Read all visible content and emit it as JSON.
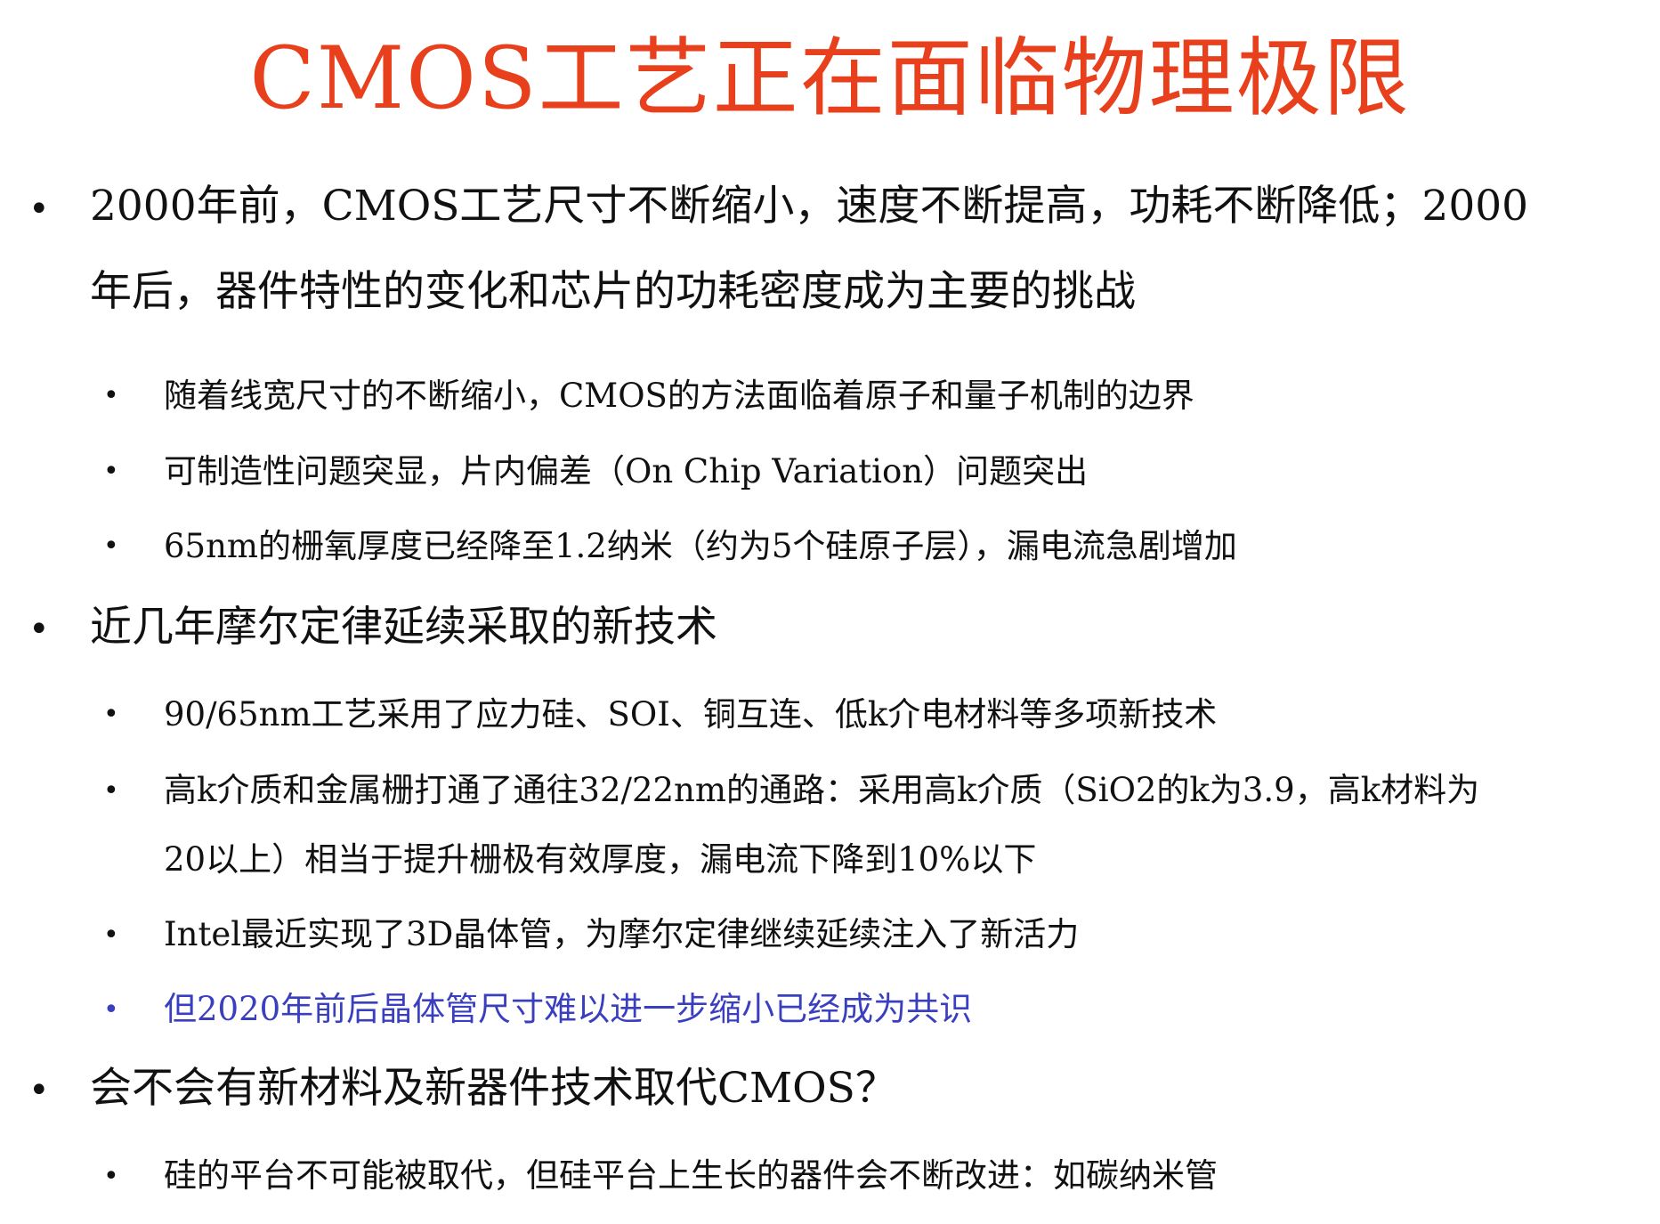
{
  "title": "CMOS工艺正在面临物理极限",
  "colors": {
    "title": "#e8401c",
    "text": "#111111",
    "highlight": "#3a3fc0"
  },
  "bullets": [
    {
      "lines": [
        "2000年前，CMOS工艺尺寸不断缩小，速度不断提高，功耗不断降低；2000",
        "年后，器件特性的变化和芯片的功耗密度成为主要的挑战"
      ],
      "sub": [
        {
          "lines": [
            "随着线宽尺寸的不断缩小，CMOS的方法面临着原子和量子机制的边界"
          ]
        },
        {
          "lines": [
            "可制造性问题突显，片内偏差（On Chip Variation）问题突出"
          ]
        },
        {
          "lines": [
            "65nm的栅氧厚度已经降至1.2纳米（约为5个硅原子层），漏电流急剧增加"
          ]
        }
      ]
    },
    {
      "lines": [
        "近几年摩尔定律延续采取的新技术"
      ],
      "sub": [
        {
          "lines": [
            "90/65nm工艺采用了应力硅、SOI、铜互连、低k介电材料等多项新技术"
          ]
        },
        {
          "lines": [
            "高k介质和金属栅打通了通往32/22nm的通路：采用高k介质（SiO2的k为3.9，高k材料为",
            "20以上）相当于提升栅极有效厚度，漏电流下降到10%以下"
          ]
        },
        {
          "lines": [
            "Intel最近实现了3D晶体管，为摩尔定律继续延续注入了新活力"
          ]
        },
        {
          "lines": [
            "但2020年前后晶体管尺寸难以进一步缩小已经成为共识"
          ],
          "highlight": true
        }
      ]
    },
    {
      "lines": [
        "会不会有新材料及新器件技术取代CMOS？"
      ],
      "sub": [
        {
          "lines": [
            "硅的平台不可能被取代，但硅平台上生长的器件会不断改进：如碳纳米管"
          ]
        }
      ]
    }
  ]
}
